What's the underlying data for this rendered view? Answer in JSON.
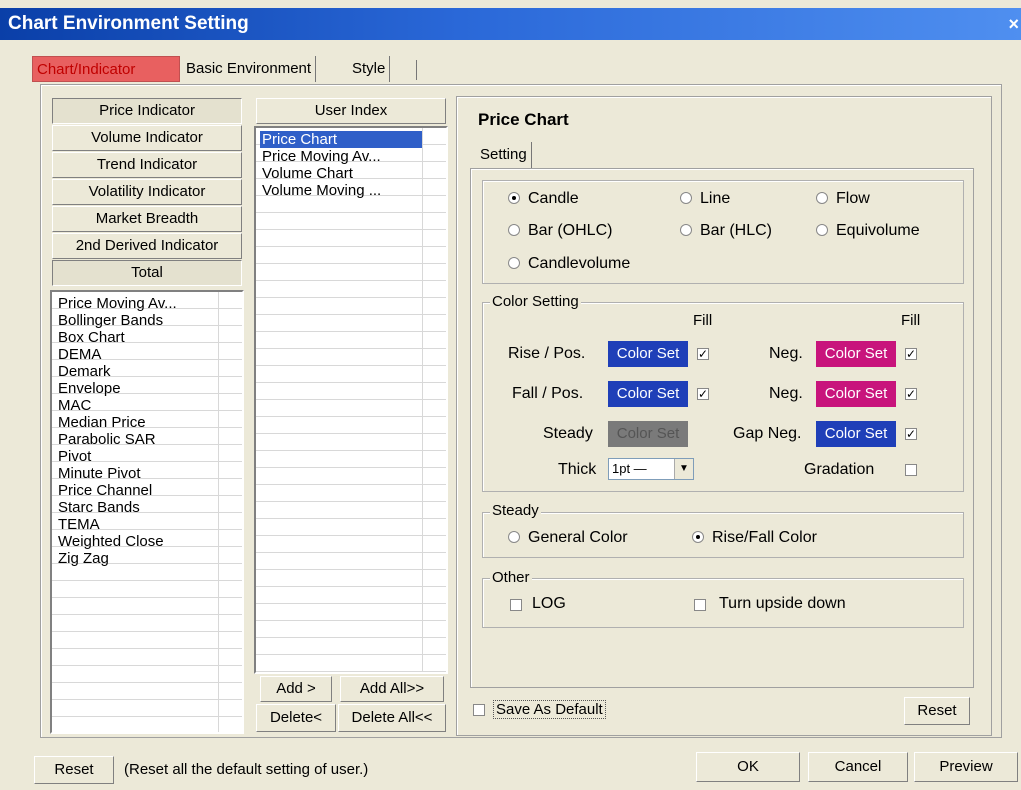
{
  "window": {
    "title": "Chart Environment Setting",
    "close": "×"
  },
  "tabs": [
    "Chart/Indicator",
    "Basic Environment",
    "Style"
  ],
  "indicator_categories": [
    "Price Indicator",
    "Volume Indicator",
    "Trend Indicator",
    "Volatility Indicator",
    "Market Breadth",
    "2nd Derived Indicator",
    "Total"
  ],
  "indicator_list": [
    "Price Moving Av...",
    "Bollinger Bands",
    "Box Chart",
    "DEMA",
    "Demark",
    "Envelope",
    "MAC",
    "Median Price",
    "Parabolic SAR",
    "Pivot",
    "Minute Pivot",
    "Price Channel",
    "Starc Bands",
    "TEMA",
    "Weighted Close",
    "Zig Zag"
  ],
  "user_index": {
    "header": "User Index",
    "items": [
      "Price Chart",
      "Price Moving Av...",
      "Volume Chart",
      "Volume Moving ..."
    ],
    "selected": "Price Chart"
  },
  "list_buttons": {
    "add": "Add >",
    "add_all": "Add All>>",
    "delete": "Delete<",
    "delete_all": "Delete All<<"
  },
  "panel": {
    "title": "Price Chart",
    "tab": "Setting",
    "chart_types": {
      "candle": "Candle",
      "line": "Line",
      "flow": "Flow",
      "bar_ohlc": "Bar (OHLC)",
      "bar_hlc": "Bar (HLC)",
      "equivolume": "Equivolume",
      "candlevolume": "Candlevolume",
      "selected": "Candle"
    },
    "color_setting": {
      "label": "Color Setting",
      "fill_header": "Fill",
      "rise_pos": "Rise / Pos.",
      "fall_pos": "Fall / Pos.",
      "neg": "Neg.",
      "steady": "Steady",
      "gap_neg": "Gap Neg.",
      "thick": "Thick",
      "thick_value": "1pt —",
      "gradation": "Gradation",
      "color_set": "Color Set",
      "colors": {
        "blue": "#1f3fb8",
        "magenta": "#c8147c",
        "gray": "#7a7a7a"
      },
      "check_mark": "✓"
    },
    "steady": {
      "label": "Steady",
      "general": "General Color",
      "rise_fall": "Rise/Fall Color",
      "selected": "Rise/Fall Color"
    },
    "other": {
      "label": "Other",
      "log": "LOG",
      "upside_down": "Turn upside down"
    },
    "save_default": "Save As Default",
    "reset": "Reset"
  },
  "footer": {
    "reset": "Reset",
    "reset_note": "(Reset all the default setting of user.)",
    "ok": "OK",
    "cancel": "Cancel",
    "preview": "Preview"
  }
}
